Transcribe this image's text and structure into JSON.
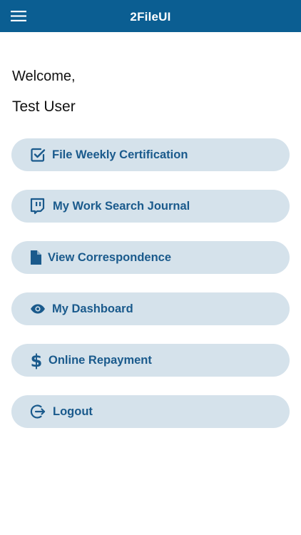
{
  "app": {
    "title": "2FileUI",
    "menu_icon": "hamburger-menu-icon"
  },
  "greeting": {
    "welcome": "Welcome,",
    "user_name": "Test User"
  },
  "colors": {
    "header_bg": "#0b5e92",
    "button_bg": "#d5e2eb",
    "button_text": "#1a5a8c"
  },
  "menu": {
    "items": [
      {
        "label": "File Weekly Certification",
        "icon": "checkbox-icon"
      },
      {
        "label": "My Work Search Journal",
        "icon": "chat-journal-icon"
      },
      {
        "label": "View Correspondence",
        "icon": "document-icon"
      },
      {
        "label": "My Dashboard",
        "icon": "eye-icon"
      },
      {
        "label": "Online Repayment",
        "icon": "dollar-icon"
      },
      {
        "label": "Logout",
        "icon": "logout-icon"
      }
    ]
  }
}
